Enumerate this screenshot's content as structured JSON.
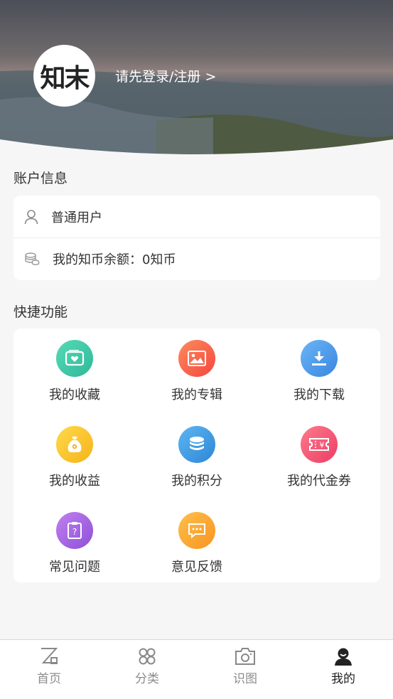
{
  "header": {
    "avatar_text": "知末",
    "login_text": "请先登录/注册 >"
  },
  "account": {
    "title": "账户信息",
    "user_type": "普通用户",
    "balance": "我的知币余额：0知币"
  },
  "quick": {
    "title": "快捷功能",
    "items": [
      {
        "label": "我的收藏",
        "icon": "favorites-icon",
        "color": "#3ec9a7"
      },
      {
        "label": "我的专辑",
        "icon": "album-icon",
        "color": "#ff6a4d"
      },
      {
        "label": "我的下载",
        "icon": "download-icon",
        "color": "#4d9cf0"
      },
      {
        "label": "我的收益",
        "icon": "money-bag-icon",
        "color": "#fbc72e"
      },
      {
        "label": "我的积分",
        "icon": "coins-icon",
        "color": "#3f9de6"
      },
      {
        "label": "我的代金券",
        "icon": "voucher-icon",
        "color": "#f25a78"
      },
      {
        "label": "常见问题",
        "icon": "faq-icon",
        "color": "#a763e0"
      },
      {
        "label": "意见反馈",
        "icon": "feedback-icon",
        "color": "#fba22f"
      }
    ]
  },
  "tabbar": {
    "tabs": [
      {
        "label": "首页",
        "icon": "home-icon",
        "active": false
      },
      {
        "label": "分类",
        "icon": "category-icon",
        "active": false
      },
      {
        "label": "识图",
        "icon": "camera-icon",
        "active": false
      },
      {
        "label": "我的",
        "icon": "profile-icon",
        "active": true
      }
    ]
  }
}
